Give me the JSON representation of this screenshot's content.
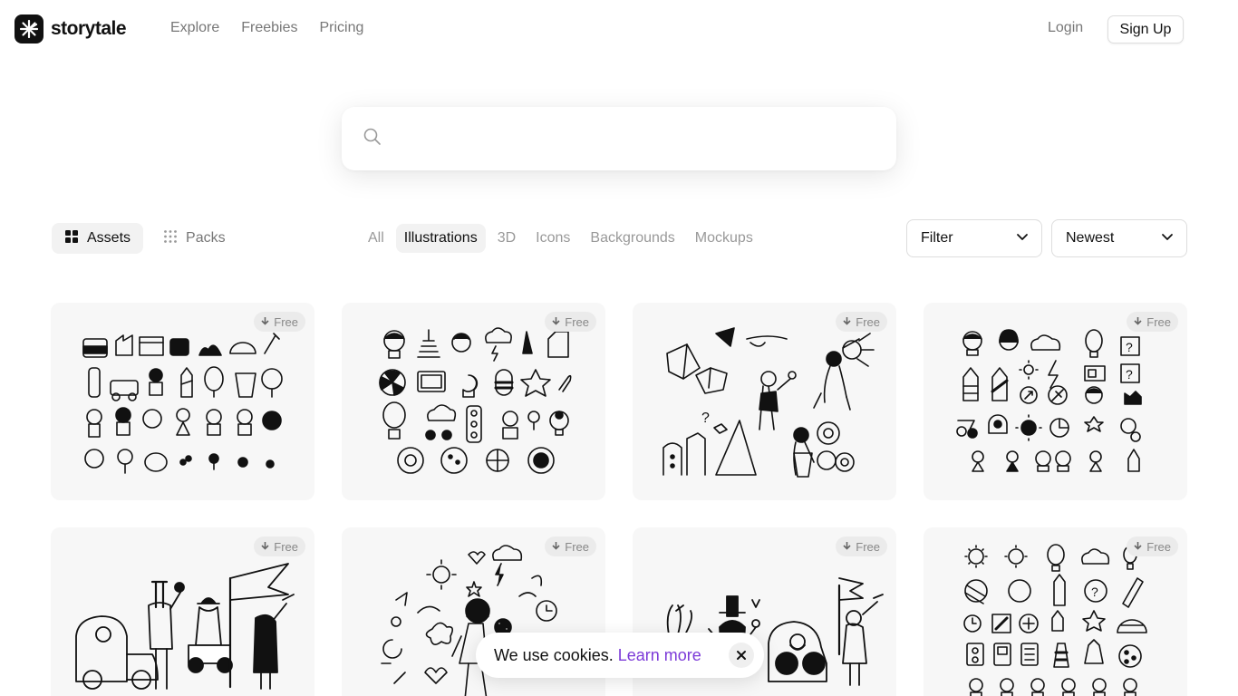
{
  "brand": {
    "name": "storytale"
  },
  "nav": {
    "explore": "Explore",
    "freebies": "Freebies",
    "pricing": "Pricing"
  },
  "auth": {
    "login": "Login",
    "signup": "Sign Up"
  },
  "search": {
    "placeholder": "",
    "value": ""
  },
  "view_toggle": {
    "assets": "Assets",
    "packs": "Packs",
    "active": "Assets"
  },
  "type_tabs": [
    "All",
    "Illustrations",
    "3D",
    "Icons",
    "Backgrounds",
    "Mockups"
  ],
  "active_type": "Illustrations",
  "filter": {
    "label": "Filter"
  },
  "sort": {
    "label": "Newest"
  },
  "cards": [
    {
      "badge": "Free",
      "subject": "doodle-icon-set"
    },
    {
      "badge": "Free",
      "subject": "hand-drawn-icon-set"
    },
    {
      "badge": "Free",
      "subject": "people-ideas-scene"
    },
    {
      "badge": "Free",
      "subject": "cute-icon-set"
    },
    {
      "badge": "Free",
      "subject": "characters-with-car-scene"
    },
    {
      "badge": "Free",
      "subject": "person-thinking-doodles"
    },
    {
      "badge": "Free",
      "subject": "characters-scene"
    },
    {
      "badge": "Free",
      "subject": "outline-icon-grid"
    }
  ],
  "cookie": {
    "text": "We use cookies.",
    "link": "Learn more"
  },
  "colors": {
    "accent_link": "#7c3ad8",
    "card_bg": "#f7f7f7",
    "text": "#111111",
    "muted": "#777777"
  }
}
